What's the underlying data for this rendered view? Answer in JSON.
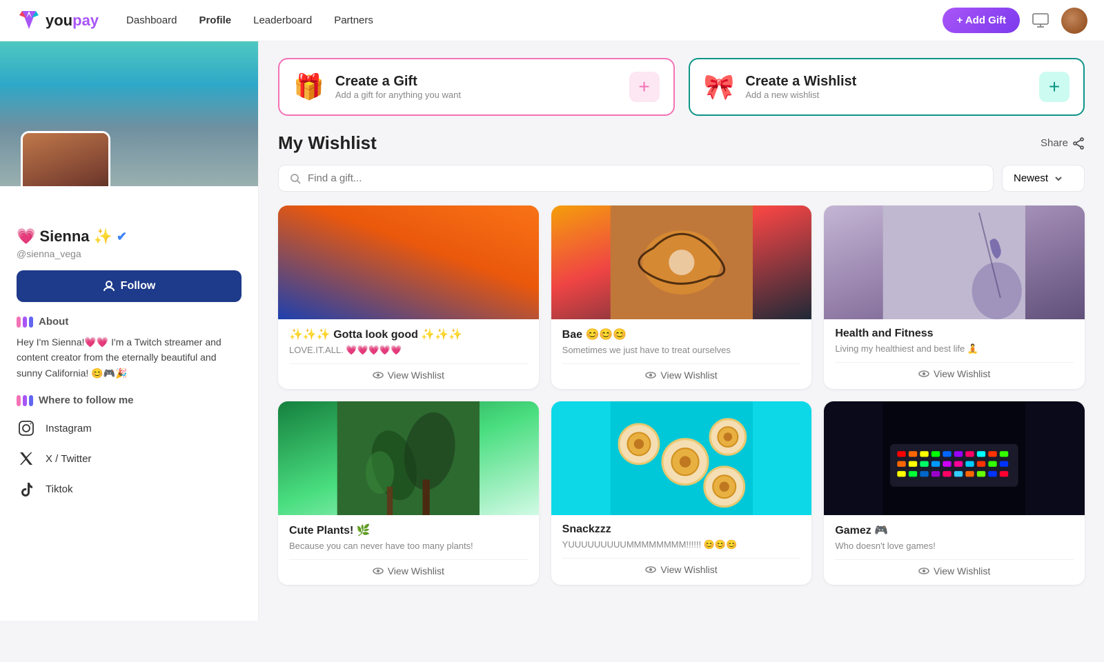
{
  "navbar": {
    "logo_text": "youpay",
    "nav_links": [
      {
        "label": "Dashboard",
        "active": false
      },
      {
        "label": "Profile",
        "active": true
      },
      {
        "label": "Leaderboard",
        "active": false
      },
      {
        "label": "Partners",
        "active": false
      }
    ],
    "add_gift_label": "+ Add Gift"
  },
  "sidebar": {
    "profile_name": "Sienna",
    "profile_handle": "@sienna_vega",
    "follow_label": "Follow",
    "about_heading": "About",
    "about_text": "Hey I'm Sienna!💗💗 I'm a Twitch streamer and content creator from the eternally beautiful and sunny California! 😊🎮🎉",
    "where_heading": "Where to follow me",
    "socials": [
      {
        "icon": "instagram",
        "label": "Instagram"
      },
      {
        "icon": "twitter",
        "label": "X / Twitter"
      },
      {
        "icon": "tiktok",
        "label": "Tiktok"
      }
    ]
  },
  "main": {
    "create_gift": {
      "title": "Create a Gift",
      "subtitle": "Add a gift for anything you want"
    },
    "create_wishlist": {
      "title": "Create a Wishlist",
      "subtitle": "Add a new wishlist"
    },
    "wishlist_title": "My Wishlist",
    "share_label": "Share",
    "search_placeholder": "Find a gift...",
    "sort_label": "Newest",
    "wishlists": [
      {
        "title": "✨✨✨ Gotta look good ✨✨✨",
        "desc": "LOVE.IT.ALL. 💗💗💗💗💗",
        "view_label": "View Wishlist",
        "img_class": "card-img-1"
      },
      {
        "title": "Bae 😊😊😊",
        "desc": "Sometimes we just have to treat ourselves",
        "view_label": "View Wishlist",
        "img_class": "card-img-2"
      },
      {
        "title": "Health and Fitness",
        "desc": "Living my healthiest and best life 🧘",
        "view_label": "View Wishlist",
        "img_class": "card-img-3"
      },
      {
        "title": "Cute Plants! 🌿",
        "desc": "Because you can never have too many plants!",
        "view_label": "View Wishlist",
        "img_class": "card-img-4"
      },
      {
        "title": "Snackzzz",
        "desc": "YUUUUUUUUUMMMMMMMM!!!!!! 😊😊😊",
        "view_label": "View Wishlist",
        "img_class": "card-img-5"
      },
      {
        "title": "Gamez 🎮",
        "desc": "Who doesn't love games!",
        "view_label": "View Wishlist",
        "img_class": "card-img-6"
      }
    ]
  }
}
